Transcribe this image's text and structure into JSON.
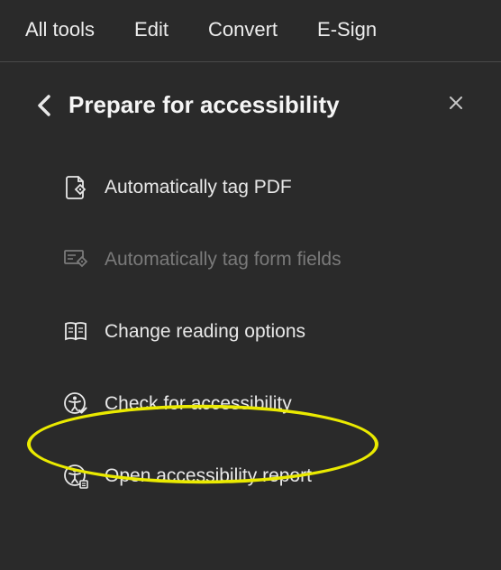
{
  "topTabs": {
    "allTools": "All tools",
    "edit": "Edit",
    "convert": "Convert",
    "esign": "E-Sign"
  },
  "panel": {
    "title": "Prepare for accessibility"
  },
  "menu": {
    "autoTagPdf": "Automatically tag PDF",
    "autoTagForm": "Automatically tag form fields",
    "changeReading": "Change reading options",
    "checkAccessibility": "Check for accessibility",
    "openReport": "Open accessibility report"
  }
}
